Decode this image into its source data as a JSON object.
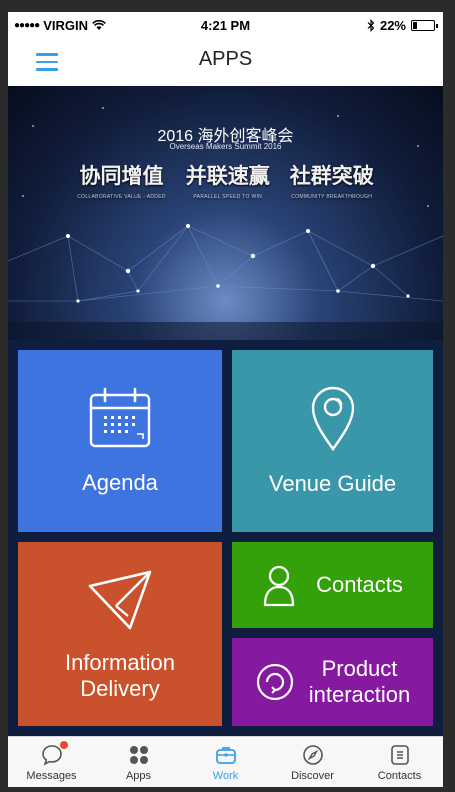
{
  "status": {
    "signal_dots": "●●●●●",
    "carrier": "VIRGIN",
    "time": "4:21 PM",
    "battery_text": "22%",
    "battery_level": 0.22
  },
  "navbar": {
    "title": "APPS"
  },
  "banner": {
    "title": "2016 海外创客峰会",
    "subtitle": "Overseas Makers Summit 2016",
    "slogans": [
      {
        "zh": "协同增值",
        "en": "COLLABORATIVE VALUE - ADDED"
      },
      {
        "zh": "并联速赢",
        "en": "PARALLEL SPEED TO WIN"
      },
      {
        "zh": "社群突破",
        "en": "COMMUNITY BREAKTHROUGH"
      }
    ]
  },
  "tiles": {
    "agenda": "Agenda",
    "venue": "Venue Guide",
    "info_line1": "Information",
    "info_line2": "Delivery",
    "contacts": "Contacts",
    "product_line1": "Product",
    "product_line2": "interaction"
  },
  "tabbar": {
    "items": [
      {
        "label": "Messages"
      },
      {
        "label": "Apps"
      },
      {
        "label": "Work"
      },
      {
        "label": "Discover"
      },
      {
        "label": "Contacts"
      }
    ]
  },
  "colors": {
    "accent": "#3c9ee5",
    "agenda": "#3e74e0",
    "venue": "#3a97aa",
    "info": "#c9512b",
    "contacts": "#34a10b",
    "product": "#851aa0",
    "badge": "#e84a2f"
  }
}
